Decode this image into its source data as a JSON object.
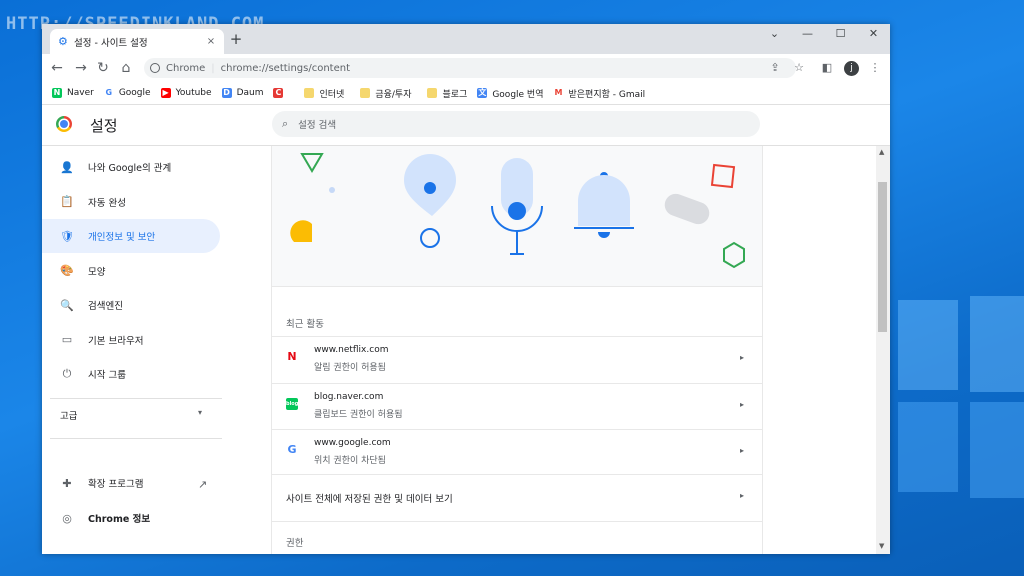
{
  "watermark": "HTTP://SPEEDINKLAND.COM",
  "browser": {
    "tab_title": "설정 - 사이트 설정",
    "tab_close": "×",
    "new_tab": "+",
    "window_controls": {
      "dropdown": "⌄",
      "minimize": "—",
      "maximize": "☐",
      "close": "✕"
    },
    "nav": {
      "back": "←",
      "forward": "→",
      "reload": "↻",
      "home": "⌂"
    },
    "omnibox": {
      "chrome_label": "Chrome",
      "separator": "|",
      "url": "chrome://settings/content"
    },
    "toolbar_right": {
      "share": "⇪",
      "star": "☆",
      "sidebar": "◧",
      "menu": "⋮"
    },
    "profile_initial": "j"
  },
  "bookmarks": [
    {
      "label": "Naver",
      "icon": "naver-icon",
      "color": "#03c75a",
      "glyph": "N"
    },
    {
      "label": "Google",
      "icon": "google-icon",
      "color": "#ffffff",
      "glyph": "G"
    },
    {
      "label": "Youtube",
      "icon": "youtube-icon",
      "color": "#ff0000",
      "glyph": "▶"
    },
    {
      "label": "Daum",
      "icon": "daum-icon",
      "color": "#4285f4",
      "glyph": "D"
    },
    {
      "label": "",
      "icon": "red-app-icon",
      "color": "#e53935",
      "glyph": "C"
    },
    {
      "label": "인터넷",
      "icon": "folder-icon",
      "color": "#f5d76e",
      "glyph": ""
    },
    {
      "label": "금융/투자",
      "icon": "folder-icon",
      "color": "#f5d76e",
      "glyph": ""
    },
    {
      "label": "블로그",
      "icon": "folder-icon",
      "color": "#f5d76e",
      "glyph": ""
    },
    {
      "label": "Google 번역",
      "icon": "translate-icon",
      "color": "#4285f4",
      "glyph": "文"
    },
    {
      "label": "받은편지함 - Gmail",
      "icon": "gmail-icon",
      "color": "#ffffff",
      "glyph": "M"
    }
  ],
  "settings": {
    "title": "설정",
    "search_placeholder": "설정 검색"
  },
  "sidebar": {
    "items": [
      {
        "label": "나와 Google의 관계",
        "icon": "person-icon",
        "glyph": "👤",
        "active": false
      },
      {
        "label": "자동 완성",
        "icon": "clipboard-icon",
        "glyph": "📋",
        "active": false
      },
      {
        "label": "개인정보 및 보안",
        "icon": "shield-icon",
        "glyph": "🛡",
        "active": true
      },
      {
        "label": "모양",
        "icon": "palette-icon",
        "glyph": "🎨",
        "active": false
      },
      {
        "label": "검색엔진",
        "icon": "search-icon",
        "glyph": "🔍",
        "active": false
      },
      {
        "label": "기본 브라우저",
        "icon": "browser-icon",
        "glyph": "▭",
        "active": false
      },
      {
        "label": "시작 그룹",
        "icon": "power-icon",
        "glyph": "⏻",
        "active": false
      }
    ],
    "advanced": "고급",
    "advanced_caret": "▾",
    "extensions": "확장 프로그램",
    "extensions_link": "↗",
    "about": "Chrome 정보"
  },
  "main": {
    "recent_title": "최근 활동",
    "recent": [
      {
        "site": "www.netflix.com",
        "detail": "알림 권한이 허용됨",
        "icon": "netflix-icon",
        "glyph": "N",
        "color": "#e50914"
      },
      {
        "site": "blog.naver.com",
        "detail": "클립보드 권한이 허용됨",
        "icon": "naver-blog-icon",
        "glyph": "blog",
        "color": "#03c75a"
      },
      {
        "site": "www.google.com",
        "detail": "위치 권한이 차단됨",
        "icon": "google-icon",
        "glyph": "G",
        "color": "#4285f4"
      }
    ],
    "view_all": "사이트 전체에 저장된 권한 및 데이터 보기",
    "permissions_title": "권한",
    "arrow": "▸"
  },
  "colors": {
    "accent": "#1a73e8",
    "active_bg": "#e8f0fe",
    "desktop_bg": "#1b86e8"
  }
}
